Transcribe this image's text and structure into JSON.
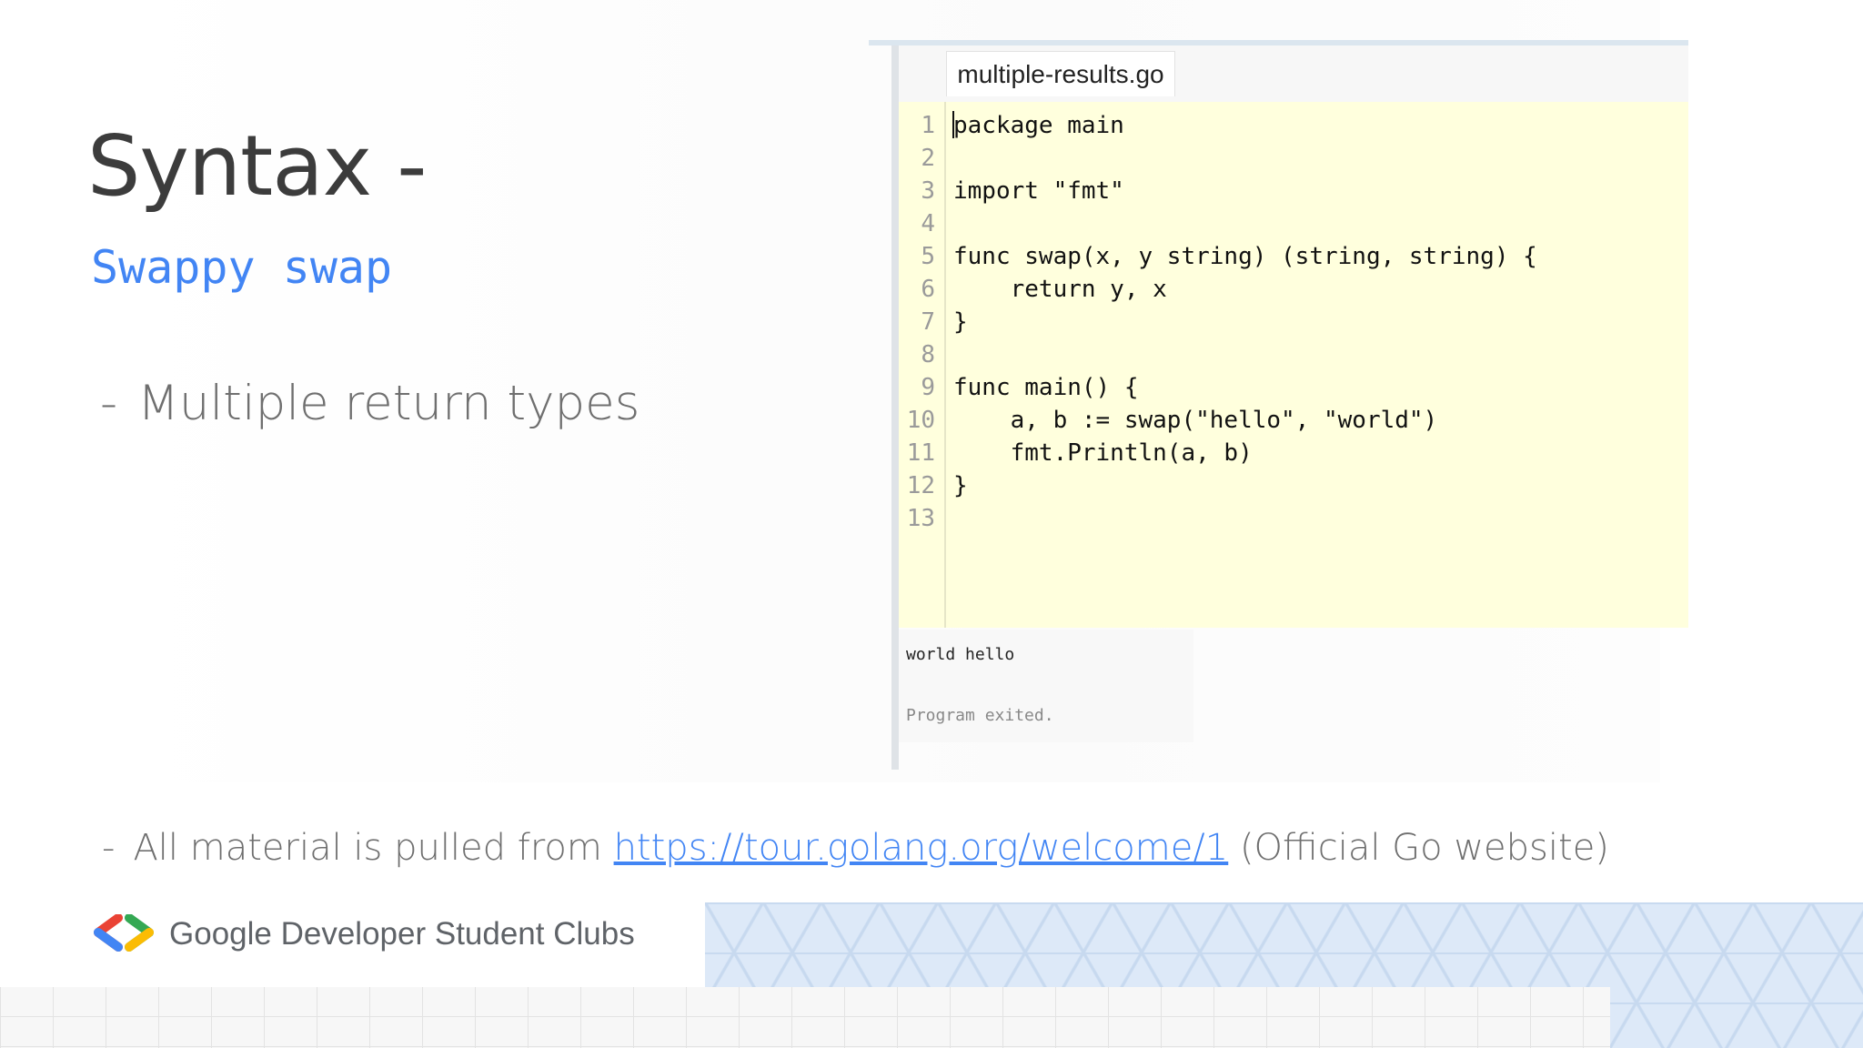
{
  "slide": {
    "title": "Syntax -",
    "subtitle": "Swappy swap",
    "bullet_dash": "-",
    "bullet_text": "Multiple return types"
  },
  "editor": {
    "tab_label": "multiple-results.go",
    "lines": [
      {
        "no": "1",
        "code": "package main"
      },
      {
        "no": "2",
        "code": ""
      },
      {
        "no": "3",
        "code": "import \"fmt\""
      },
      {
        "no": "4",
        "code": ""
      },
      {
        "no": "5",
        "code": "func swap(x, y string) (string, string) {"
      },
      {
        "no": "6",
        "code": "    return y, x"
      },
      {
        "no": "7",
        "code": "}"
      },
      {
        "no": "8",
        "code": ""
      },
      {
        "no": "9",
        "code": "func main() {"
      },
      {
        "no": "10",
        "code": "    a, b := swap(\"hello\", \"world\")"
      },
      {
        "no": "11",
        "code": "    fmt.Println(a, b)"
      },
      {
        "no": "12",
        "code": "}"
      },
      {
        "no": "13",
        "code": ""
      }
    ],
    "output_result": "world hello",
    "output_status": "Program exited."
  },
  "footer": {
    "dash": "-",
    "prefix": "All material is pulled from",
    "link_text": "https://tour.golang.org/welcome/1",
    "suffix": "(Official Go website)",
    "brand": "Google Developer Student Clubs",
    "logo_icon": "gdsc-brackets-icon"
  },
  "colors": {
    "accent_blue": "#4285f4",
    "editor_bg": "#ffffdd",
    "logo_red": "#ea4335",
    "logo_blue": "#4285f4",
    "logo_green": "#34a853",
    "logo_yellow": "#fbbc04"
  }
}
